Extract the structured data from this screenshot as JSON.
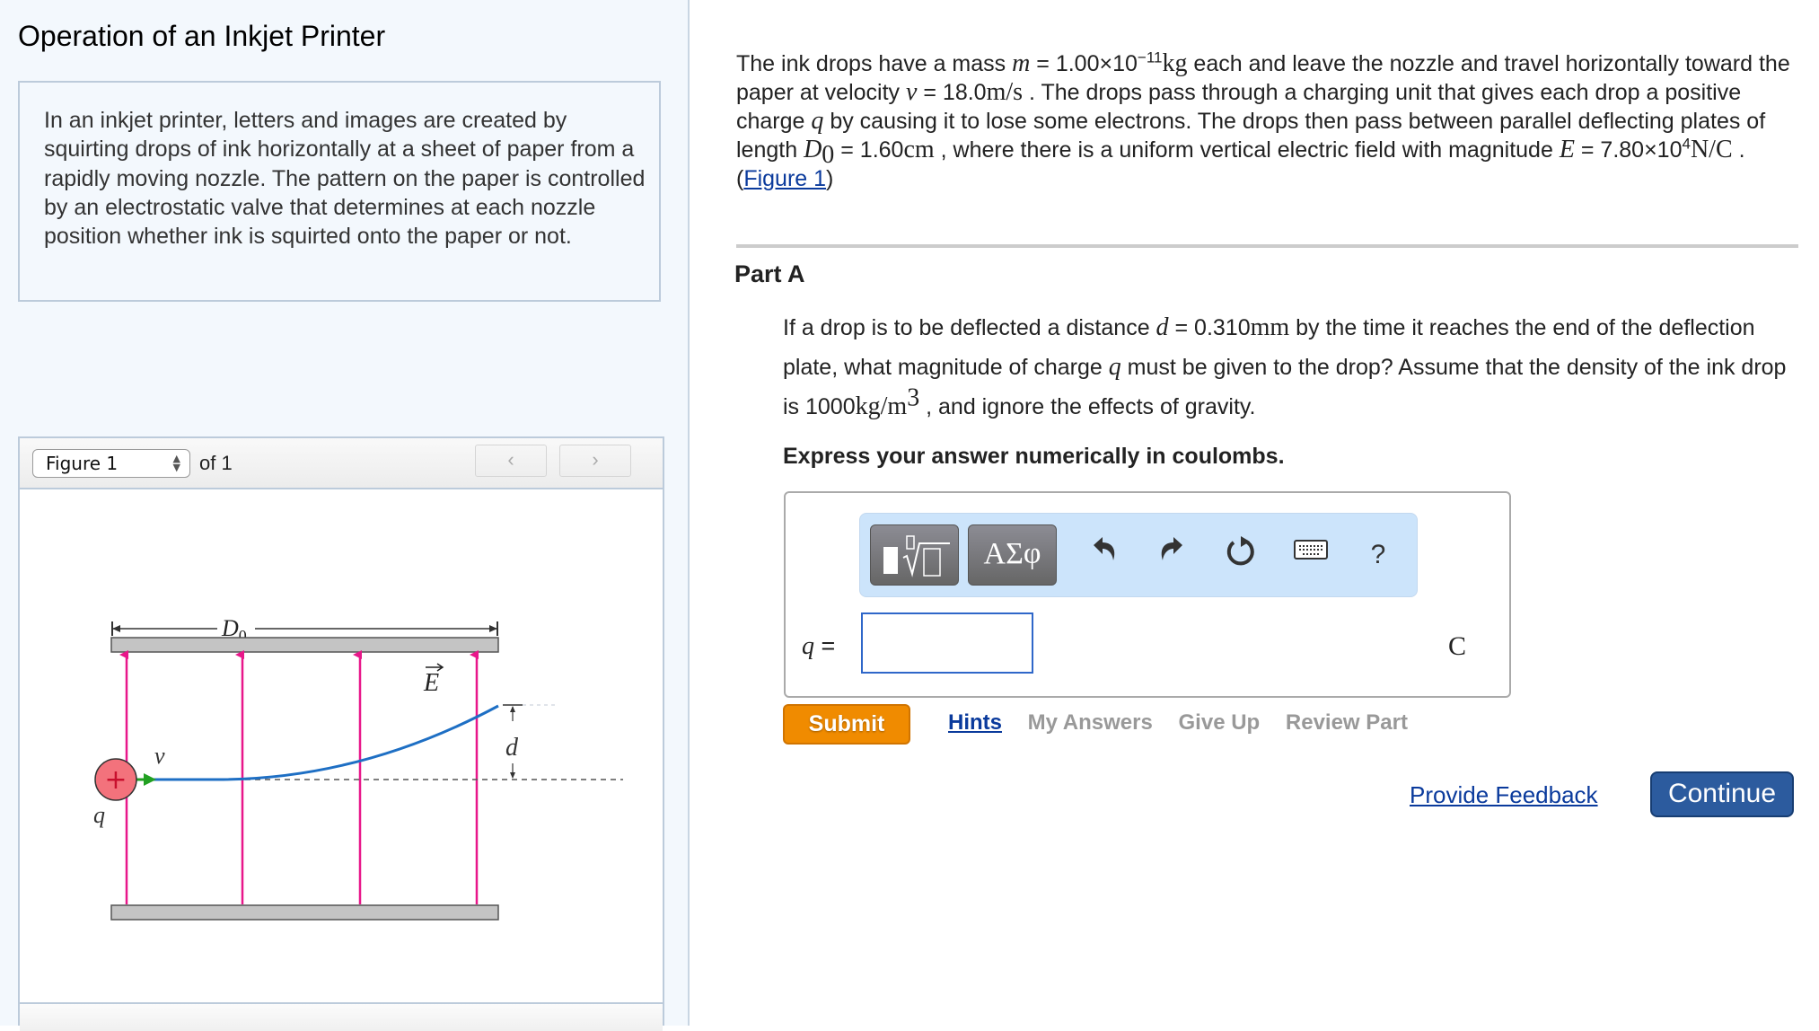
{
  "left": {
    "title": "Operation of an Inkjet Printer",
    "description": "In an inkjet printer, letters and images are created by squirting drops of ink horizontally at a sheet of paper from a rapidly moving nozzle. The pattern on the paper is controlled by an electrostatic valve that determines at each nozzle position whether ink is squirted onto the paper or not.",
    "figure_nav": {
      "selected": "Figure 1",
      "of_label": "of 1",
      "prev_icon": "chevron-left-icon",
      "next_icon": "chevron-right-icon",
      "prev_glyph": "‹",
      "next_glyph": "›"
    },
    "figure": {
      "dimension_label": "D",
      "dimension_sub": "0",
      "field_label": "E",
      "velocity_label": "v",
      "charge_label": "q",
      "deflection_label": "d",
      "charge_sign": "+",
      "colors": {
        "field_arrows": "#e8178a",
        "trajectory": "#1e6fc4",
        "velocity_arrow": "#22a022",
        "drop_fill": "#f3727c",
        "drop_sign": "#c8102e",
        "plates": "#c4c4c4"
      }
    }
  },
  "intro": {
    "line1_a": "The ink drops have a mass ",
    "m_sym": "m",
    "line1_b": " = 1.00×10",
    "m_exp": "−11",
    "m_unit": "kg",
    "line1_c": " each and leave the nozzle and travel horizontally toward the paper at velocity ",
    "v_sym": "v",
    "line2_a": " = 18.0",
    "v_unit": "m/s",
    "line2_b": " . The drops pass through a charging unit that gives each drop a positive charge ",
    "q_sym": "q",
    "line3_a": " by causing it to lose some electrons. The drops then pass between parallel deflecting plates of length ",
    "d0_sym": "D",
    "d0_sub": "0",
    "line4_a": " = 1.60",
    "d0_unit": "cm",
    "line4_b": " , where there is a uniform vertical electric field with magnitude ",
    "e_sym": "E",
    "line5_a": " = 7.80×10",
    "e_exp": "4",
    "e_unit": "N/C",
    "line5_b": " . (",
    "figure_link": "Figure 1",
    "line5_c": ")"
  },
  "part": {
    "title": "Part A",
    "q_a": "If a drop is to be deflected a distance ",
    "d_sym": "d",
    "q_b": " = 0.310",
    "d_unit": "mm",
    "q_c": " by the time it reaches the end of the deflection plate, what magnitude of charge ",
    "q_sym": "q",
    "q_d": " must be given to the drop? Assume that the density of the ink drop is 1000",
    "rho_unit": "kg/m",
    "rho_exp": "3",
    "q_e": " , and ignore the effects of gravity.",
    "express": "Express your answer numerically in coulombs."
  },
  "answer": {
    "toolbar": {
      "template_icon": "template-root-icon",
      "symbols_label": "ΑΣφ",
      "undo_icon": "undo-icon",
      "redo_icon": "redo-icon",
      "reset_icon": "reset-icon",
      "keyboard_icon": "keyboard-icon",
      "help_label": "?"
    },
    "variable": "q",
    "equals": " =",
    "value": "",
    "unit": "C"
  },
  "actions": {
    "submit": "Submit",
    "hints": "Hints",
    "my_answers": "My Answers",
    "give_up": "Give Up",
    "review_part": "Review Part",
    "feedback": "Provide Feedback",
    "continue": "Continue"
  }
}
